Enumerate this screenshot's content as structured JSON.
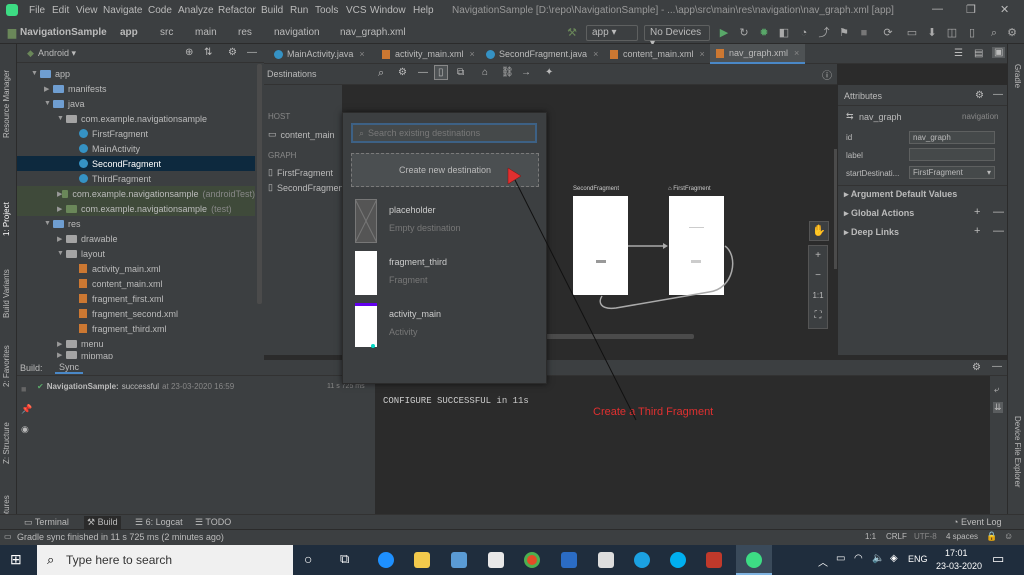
{
  "menubar": {
    "items": [
      "File",
      "Edit",
      "View",
      "Navigate",
      "Code",
      "Analyze",
      "Refactor",
      "Build",
      "Run",
      "Tools",
      "VCS",
      "Window",
      "Help"
    ],
    "title": "NavigationSample [D:\\repo\\NavigationSample] - ...\\app\\src\\main\\res\\navigation\\nav_graph.xml [app]"
  },
  "navbar": {
    "crumbs": [
      "NavigationSample",
      "app",
      "src",
      "main",
      "res",
      "navigation",
      "nav_graph.xml"
    ],
    "run_config": "app",
    "devices": "No Devices"
  },
  "left_strip": [
    "Resource Manager",
    "1: Project",
    "Build Variants",
    "2: Favorites",
    "Z: Structure",
    "Layout Captures"
  ],
  "right_strip": [
    "Gradle",
    "Device File Explorer"
  ],
  "project": {
    "view": "Android",
    "tree": [
      {
        "label": "app",
        "indent": 0,
        "type": "folder-blue",
        "arrow": "▼"
      },
      {
        "label": "manifests",
        "indent": 1,
        "type": "folder-blue",
        "arrow": "▶"
      },
      {
        "label": "java",
        "indent": 1,
        "type": "folder-blue",
        "arrow": "▼"
      },
      {
        "label": "com.example.navigationsample",
        "indent": 2,
        "type": "folder",
        "arrow": "▼"
      },
      {
        "label": "FirstFragment",
        "indent": 3,
        "type": "class",
        "arrow": ""
      },
      {
        "label": "MainActivity",
        "indent": 3,
        "type": "class",
        "arrow": ""
      },
      {
        "label": "SecondFragment",
        "indent": 3,
        "type": "class",
        "arrow": "",
        "selected": true
      },
      {
        "label": "ThirdFragment",
        "indent": 3,
        "type": "class",
        "arrow": ""
      },
      {
        "label": "com.example.navigationsample",
        "suffix": "(androidTest)",
        "indent": 2,
        "type": "folder-green",
        "arrow": "▶",
        "tinted": true
      },
      {
        "label": "com.example.navigationsample",
        "suffix": "(test)",
        "indent": 2,
        "type": "folder-green",
        "arrow": "▶",
        "tinted": true
      },
      {
        "label": "res",
        "indent": 1,
        "type": "folder-blue",
        "arrow": "▼"
      },
      {
        "label": "drawable",
        "indent": 2,
        "type": "folder",
        "arrow": "▶"
      },
      {
        "label": "layout",
        "indent": 2,
        "type": "folder",
        "arrow": "▼"
      },
      {
        "label": "activity_main.xml",
        "indent": 3,
        "type": "xml",
        "arrow": ""
      },
      {
        "label": "content_main.xml",
        "indent": 3,
        "type": "xml",
        "arrow": ""
      },
      {
        "label": "fragment_first.xml",
        "indent": 3,
        "type": "xml",
        "arrow": ""
      },
      {
        "label": "fragment_second.xml",
        "indent": 3,
        "type": "xml",
        "arrow": ""
      },
      {
        "label": "fragment_third.xml",
        "indent": 3,
        "type": "xml",
        "arrow": ""
      },
      {
        "label": "menu",
        "indent": 2,
        "type": "folder",
        "arrow": "▶"
      },
      {
        "label": "mipmap",
        "indent": 2,
        "type": "folder",
        "arrow": "▶"
      }
    ]
  },
  "editor_tabs": [
    "MainActivity.java",
    "activity_main.xml",
    "SecondFragment.java",
    "content_main.xml",
    "nav_graph.xml"
  ],
  "destinations": {
    "title": "Destinations",
    "host_label": "HOST",
    "host_item": "content_main",
    "graph_label": "GRAPH",
    "graph_items": [
      "FirstFragment",
      "SecondFragment"
    ]
  },
  "popup": {
    "search_placeholder": "Search existing destinations",
    "create_label": "Create new destination",
    "items": [
      {
        "name": "placeholder",
        "kind": "Empty destination"
      },
      {
        "name": "fragment_third",
        "kind": "Fragment"
      },
      {
        "name": "activity_main",
        "kind": "Activity"
      }
    ]
  },
  "graph": {
    "second_label": "SecondFragment",
    "first_label": "FirstFragment"
  },
  "zoom": [
    "+",
    "−",
    "1:1",
    "⛶"
  ],
  "attributes": {
    "title": "Attributes",
    "nav_name": "nav_graph",
    "nav_type": "navigation",
    "id_label": "id",
    "id_value": "nav_graph",
    "label_label": "label",
    "start_label": "startDestinati...",
    "start_value": "FirstFragment",
    "sections": [
      "Argument Default Values",
      "Global Actions",
      "Deep Links"
    ]
  },
  "build": {
    "tab_build": "Build:",
    "tab_sync": "Sync",
    "result_project": "NavigationSample:",
    "result_text": "successful",
    "result_time": "at 23-03-2020 16:59",
    "duration": "11 s 725 ms",
    "console": "CONFIGURE SUCCESSFUL in 11s"
  },
  "annotation": "Create a Third Fragment",
  "toolwindows": [
    "Terminal",
    "Build",
    "6: Logcat",
    "TODO"
  ],
  "event_log": "Event Log",
  "status": {
    "message": "Gradle sync finished in 11 s 725 ms (2 minutes ago)",
    "position": "1:1",
    "line_sep": "CRLF",
    "encoding": "UTF-8",
    "indent": "4 spaces"
  },
  "taskbar": {
    "search_placeholder": "Type here to search",
    "lang": "ENG",
    "time": "17:01",
    "date": "23-03-2020"
  }
}
